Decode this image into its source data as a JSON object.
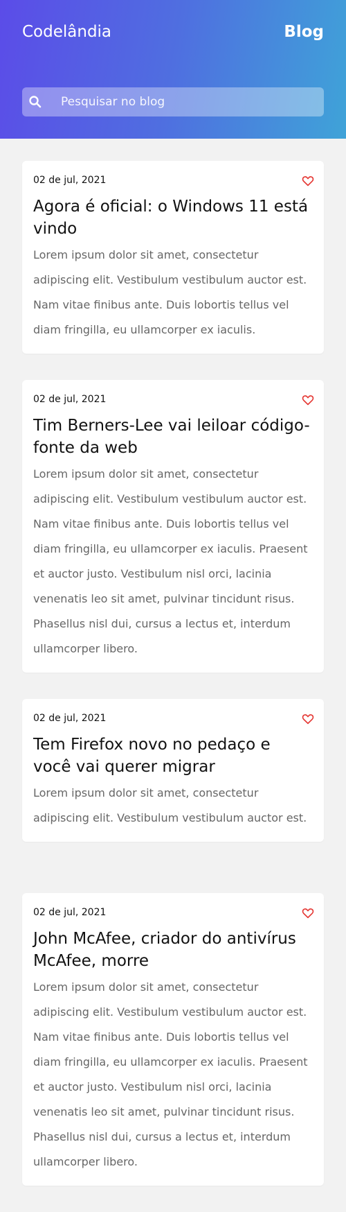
{
  "header": {
    "brand": "Codelândia",
    "nav_link": "Blog",
    "search_placeholder": "Pesquisar no blog"
  },
  "colors": {
    "gradient_start": "#5b4ce8",
    "gradient_end": "#3fa3d8",
    "heart": "#e53935",
    "body_text": "#666666"
  },
  "posts": [
    {
      "date": "02 de jul, 2021",
      "title": "Agora é oficial: o Windows 11 está vindo",
      "text": "Lorem ipsum dolor sit amet, consectetur adipiscing elit. Vestibulum vestibulum auctor est. Nam vitae finibus ante. Duis lobortis tellus vel diam fringilla, eu ullamcorper ex iaculis."
    },
    {
      "date": "02 de jul, 2021",
      "title": "Tim Berners-Lee vai leiloar código-fonte da web",
      "text": "Lorem ipsum dolor sit amet, consectetur adipiscing elit. Vestibulum vestibulum auctor est. Nam vitae finibus ante. Duis lobortis tellus vel diam fringilla, eu ullamcorper ex iaculis. Praesent et auctor justo. Vestibulum nisl orci, lacinia venenatis leo sit amet, pulvinar tincidunt risus. Phasellus nisl dui, cursus a lectus et, interdum ullamcorper libero."
    },
    {
      "date": "02 de jul, 2021",
      "title": "Tem Firefox novo no pedaço e você vai querer migrar",
      "text": "Lorem ipsum dolor sit amet, consectetur adipiscing elit. Vestibulum vestibulum auctor est."
    },
    {
      "date": "02 de jul, 2021",
      "title": "John McAfee, criador do antivírus McAfee, morre",
      "text": "Lorem ipsum dolor sit amet, consectetur adipiscing elit. Vestibulum vestibulum auctor est. Nam vitae finibus ante. Duis lobortis tellus vel diam fringilla, eu ullamcorper ex iaculis. Praesent et auctor justo. Vestibulum nisl orci, lacinia venenatis leo sit amet, pulvinar tincidunt risus. Phasellus nisl dui, cursus a lectus et, interdum ullamcorper libero."
    }
  ]
}
